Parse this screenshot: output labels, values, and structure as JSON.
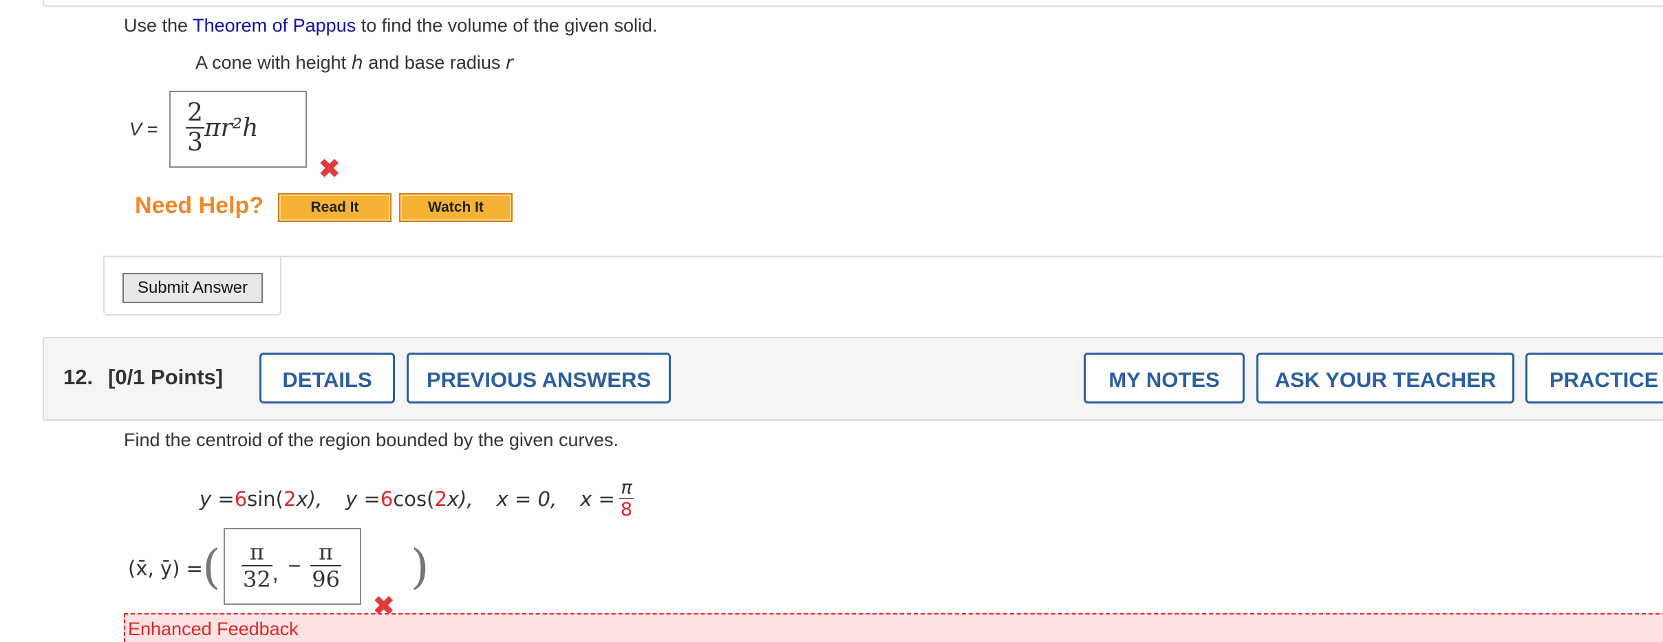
{
  "q11": {
    "prompt_prefix": "Use the ",
    "prompt_link": "Theorem of Pappus",
    "prompt_suffix": " to find the volume of the given solid.",
    "solid_prefix": "A cone with height ",
    "solid_h": "h",
    "solid_mid": " and base radius ",
    "solid_r": "r",
    "answer_label": "V =",
    "answer": {
      "numerator": "2",
      "denominator": "3",
      "rest": "πr²h"
    },
    "result_icon": "incorrect-x-icon",
    "need_help": "Need Help?",
    "read_it": "Read It",
    "watch_it": "Watch It",
    "submit": "Submit Answer"
  },
  "q12": {
    "number": "12.",
    "points": "[0/1 Points]",
    "tabs": {
      "details": "DETAILS",
      "previous_answers": "PREVIOUS ANSWERS",
      "my_notes": "MY NOTES",
      "ask_teacher": "ASK YOUR TEACHER",
      "practice": "PRACTICE A"
    },
    "prompt": "Find the centroid of the region bounded by the given curves.",
    "curves": {
      "c1_pre": "y = ",
      "c1_coef": "6",
      "c1_mid": " sin(",
      "c1_arg": "2",
      "c1_post": "x),",
      "c2_pre": "y = ",
      "c2_coef": "6",
      "c2_mid": " cos(",
      "c2_arg": "2",
      "c2_post": "x),",
      "c3": "x = 0,",
      "c4_pre": "x = ",
      "c4_num": "π",
      "c4_den": "8"
    },
    "answer_label": "(x̄, ȳ) =",
    "answer": {
      "f1_num": "π",
      "f1_den": "32",
      "separator": ",",
      "minus": "−",
      "f2_num": "π",
      "f2_den": "96"
    },
    "result_icon": "incorrect-x-icon",
    "feedback_label": "Enhanced Feedback"
  },
  "colors": {
    "accent_blue": "#2b5f9e",
    "help_orange": "#f0882b",
    "incorrect_red": "#e0393e"
  }
}
